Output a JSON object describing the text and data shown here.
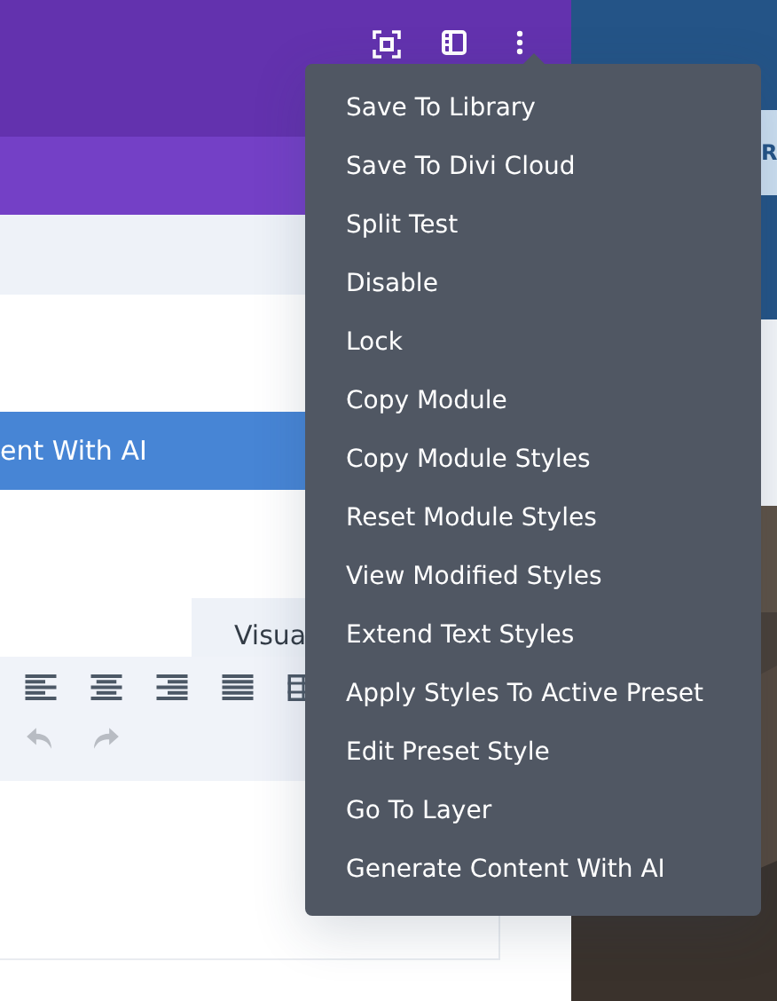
{
  "ai_button": {
    "label": "ent With AI"
  },
  "editor_tabs": [
    {
      "label": "Visua",
      "selected": true
    }
  ],
  "history_buttons": [
    {
      "kind": "undo",
      "disabled": true
    },
    {
      "kind": "redo",
      "disabled": true
    }
  ],
  "preview_heading": {
    "text": "R"
  },
  "context_menu": {
    "items": [
      {
        "label": "Save To Library"
      },
      {
        "label": "Save To Divi Cloud"
      },
      {
        "label": "Split Test"
      },
      {
        "label": "Disable"
      },
      {
        "label": "Lock"
      },
      {
        "label": "Copy Module"
      },
      {
        "label": "Copy Module Styles"
      },
      {
        "label": "Reset Module Styles"
      },
      {
        "label": "View Modified Styles"
      },
      {
        "label": "Extend Text Styles"
      },
      {
        "label": "Apply Styles To Active Preset"
      },
      {
        "label": "Edit Preset Style"
      },
      {
        "label": "Go To Layer"
      },
      {
        "label": "Generate Content With AI"
      }
    ]
  }
}
